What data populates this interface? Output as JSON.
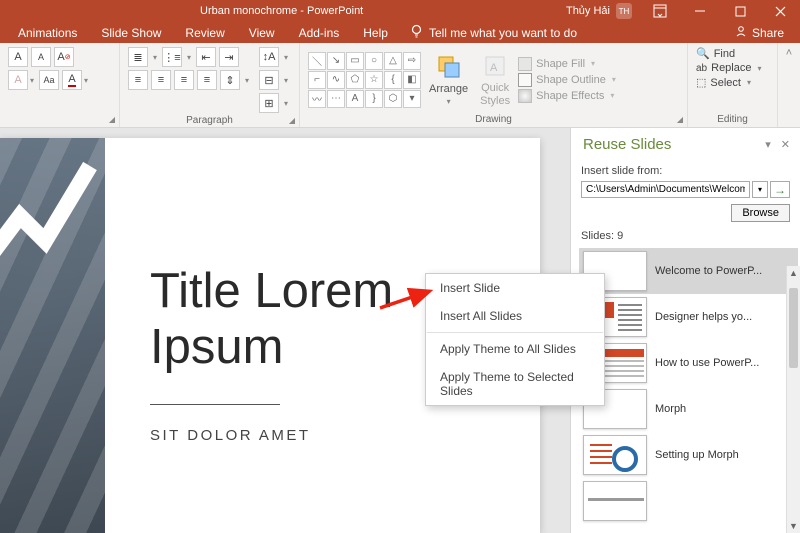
{
  "titlebar": {
    "document": "Urban monochrome - PowerPoint",
    "user": "Thủy Hải",
    "initials": "TH"
  },
  "tabs": {
    "animations": "Animations",
    "slideshow": "Slide Show",
    "review": "Review",
    "view": "View",
    "addins": "Add-ins",
    "help": "Help",
    "tellme": "Tell me what you want to do",
    "share": "Share"
  },
  "ribbon": {
    "paragraph_label": "Paragraph",
    "drawing_label": "Drawing",
    "editing_label": "Editing",
    "arrange": "Arrange",
    "quick_styles": "Quick\nStyles",
    "shape_fill": "Shape Fill",
    "shape_outline": "Shape Outline",
    "shape_effects": "Shape Effects",
    "find": "Find",
    "replace": "Replace",
    "select": "Select"
  },
  "slide": {
    "title_line1": "Title Lorem",
    "title_line2": "Ipsum",
    "subtitle": "SIT DOLOR AMET"
  },
  "context_menu": {
    "insert_slide": "Insert Slide",
    "insert_all": "Insert All Slides",
    "apply_all": "Apply Theme to All Slides",
    "apply_sel": "Apply Theme to Selected Slides"
  },
  "reuse": {
    "title": "Reuse Slides",
    "insert_from": "Insert slide from:",
    "path": "C:\\Users\\Admin\\Documents\\Welcome to P",
    "browse": "Browse",
    "count": "Slides: 9",
    "items": [
      "Welcome to PowerP...",
      "Designer helps yo...",
      "How to use PowerP...",
      "Morph",
      "Setting up Morph",
      ""
    ]
  }
}
